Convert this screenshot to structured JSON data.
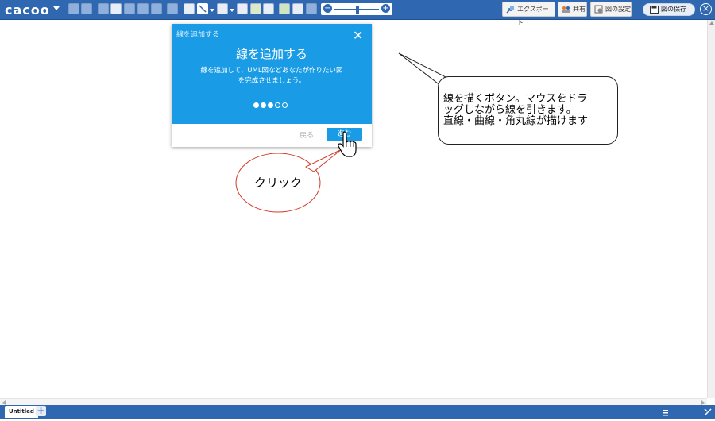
{
  "toolbar": {
    "logo": "cacoo",
    "export_label": "エクスポート",
    "share_label": "共有",
    "settings_label": "図の設定",
    "save_label": "図の保存",
    "close_symbol": "×",
    "zoom_minus": "−",
    "zoom_plus": "+"
  },
  "tour": {
    "small_title": "線を追加する",
    "title": "線を追加する",
    "desc_line1": "線を追加して、UML図などあなたが作りたい図",
    "desc_line2": "を完成させましょう。",
    "total_steps": 5,
    "current_step": 3,
    "back_label": "戻る",
    "next_label": "進む",
    "close_symbol": "✕"
  },
  "callouts": {
    "right_line1": "線を描くボタン。マウスをドラ",
    "right_line2": "ッグしながら線を引きます。",
    "right_line3": "直線・曲線・角丸線が描けます",
    "click_label": "クリック"
  },
  "bottom": {
    "sheet_label": "Untitled",
    "add_sheet_symbol": "+"
  },
  "colors": {
    "toolbar_blue": "#2f67b1",
    "tour_blue": "#1a9be6",
    "bubble_red": "#d23a2a"
  }
}
